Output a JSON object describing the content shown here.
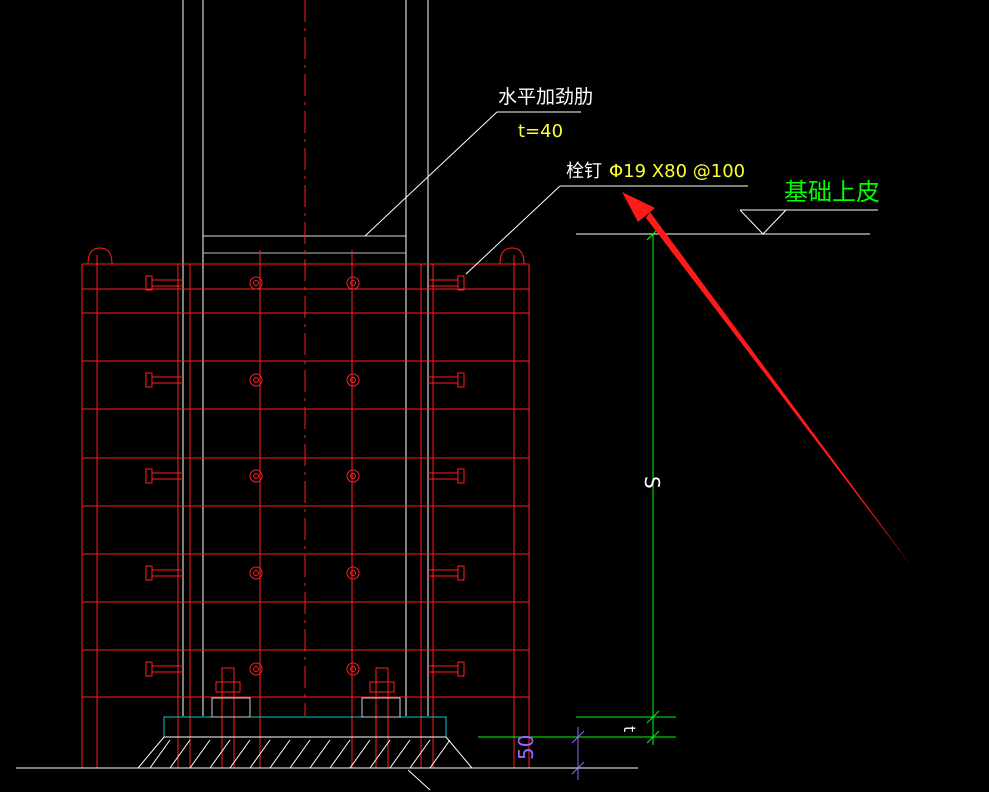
{
  "labels": {
    "stiffener_title": "水平加劲肋",
    "stiffener_thickness": "t=40",
    "stud_label": "栓钉",
    "stud_spec": "Φ19 X80 @100",
    "foundation_top": "基础上皮",
    "dim_s": "S",
    "dim_t": "t",
    "dim_50": "50"
  },
  "colors": {
    "background": "#000000",
    "rebar": "#ff2020",
    "steel": "#ffffff",
    "leader": "#ffffff",
    "dimension": "#00ff00",
    "foundation_text": "#00ff00",
    "spec_text": "#ffff33",
    "arrow": "#ff1a1a"
  }
}
